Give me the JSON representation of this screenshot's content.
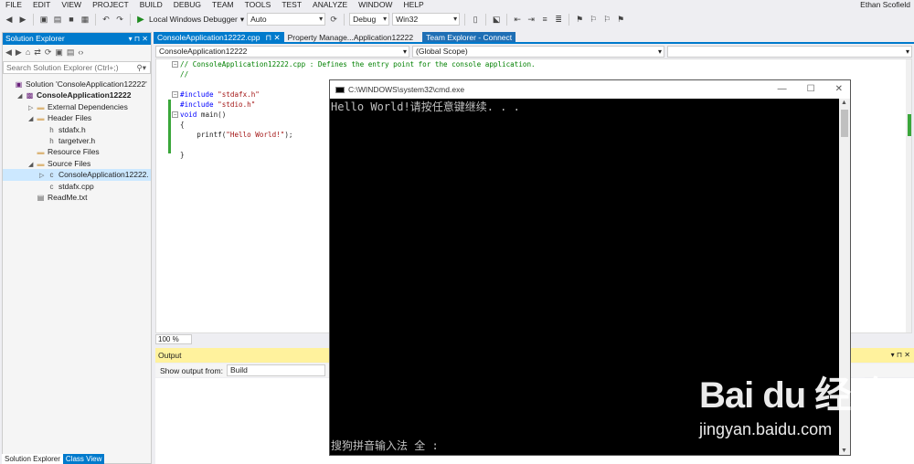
{
  "menu": [
    "FILE",
    "EDIT",
    "VIEW",
    "PROJECT",
    "BUILD",
    "DEBUG",
    "TEAM",
    "TOOLS",
    "TEST",
    "ANALYZE",
    "WINDOW",
    "HELP"
  ],
  "user": "Ethan Scofield",
  "toolbar": {
    "debugger_label": "Local Windows Debugger",
    "solution_config": "Debug",
    "platform": "Win32",
    "auto_combo": "Auto"
  },
  "solution_explorer": {
    "title": "Solution Explorer",
    "search_placeholder": "Search Solution Explorer (Ctrl+;)",
    "nodes": [
      {
        "label": "Solution 'ConsoleApplication12222'",
        "indent": 0,
        "expand": "",
        "icon": "solution-icon",
        "bold": false,
        "selected": false
      },
      {
        "label": "ConsoleApplication12222",
        "indent": 1,
        "expand": "◢",
        "icon": "project-icon",
        "bold": true,
        "selected": false
      },
      {
        "label": "External Dependencies",
        "indent": 2,
        "expand": "▷",
        "icon": "folder-icon",
        "bold": false,
        "selected": false
      },
      {
        "label": "Header Files",
        "indent": 2,
        "expand": "◢",
        "icon": "folder-icon",
        "bold": false,
        "selected": false
      },
      {
        "label": "stdafx.h",
        "indent": 3,
        "expand": "",
        "icon": "header-file-icon",
        "bold": false,
        "selected": false
      },
      {
        "label": "targetver.h",
        "indent": 3,
        "expand": "",
        "icon": "header-file-icon",
        "bold": false,
        "selected": false
      },
      {
        "label": "Resource Files",
        "indent": 2,
        "expand": "",
        "icon": "folder-icon",
        "bold": false,
        "selected": false
      },
      {
        "label": "Source Files",
        "indent": 2,
        "expand": "◢",
        "icon": "folder-icon",
        "bold": false,
        "selected": false
      },
      {
        "label": "ConsoleApplication12222.",
        "indent": 3,
        "expand": "▷",
        "icon": "cpp-file-icon",
        "bold": false,
        "selected": true
      },
      {
        "label": "stdafx.cpp",
        "indent": 3,
        "expand": "",
        "icon": "cpp-file-icon",
        "bold": false,
        "selected": false
      },
      {
        "label": "ReadMe.txt",
        "indent": 2,
        "expand": "",
        "icon": "text-file-icon",
        "bold": false,
        "selected": false
      }
    ],
    "bottom_tabs": [
      "Solution Explorer",
      "Class View"
    ]
  },
  "editor": {
    "tabs": [
      {
        "label": "ConsoleApplication12222.cpp",
        "state": "active"
      },
      {
        "label": "Property Manage...Application12222",
        "state": "normal"
      },
      {
        "label": "Team Explorer - Connect",
        "state": "inactive"
      }
    ],
    "nav_file": "ConsoleApplication12222",
    "nav_scope": "(Global Scope)",
    "zoom": "100 %",
    "lines": [
      {
        "parts": [
          {
            "t": "// ConsoleApplication12222.cpp : Defines the entry point for the console application.",
            "c": "c-cmt"
          }
        ]
      },
      {
        "parts": [
          {
            "t": "//",
            "c": "c-cmt"
          }
        ]
      },
      {
        "parts": [
          {
            "t": "",
            "c": ""
          }
        ]
      },
      {
        "parts": [
          {
            "t": "#include",
            "c": "c-kw"
          },
          {
            "t": " ",
            "c": ""
          },
          {
            "t": "\"stdafx.h\"",
            "c": "c-str"
          }
        ]
      },
      {
        "parts": [
          {
            "t": "#include",
            "c": "c-kw"
          },
          {
            "t": " ",
            "c": ""
          },
          {
            "t": "\"stdio.h\"",
            "c": "c-str"
          }
        ]
      },
      {
        "parts": [
          {
            "t": "void",
            "c": "c-kw"
          },
          {
            "t": " main()",
            "c": ""
          }
        ]
      },
      {
        "parts": [
          {
            "t": "{",
            "c": ""
          }
        ]
      },
      {
        "parts": [
          {
            "t": "    printf(",
            "c": ""
          },
          {
            "t": "\"Hello World!\"",
            "c": "c-str"
          },
          {
            "t": ");",
            "c": ""
          }
        ]
      },
      {
        "parts": [
          {
            "t": "",
            "c": ""
          }
        ]
      },
      {
        "parts": [
          {
            "t": "}",
            "c": ""
          }
        ]
      }
    ]
  },
  "output": {
    "title": "Output",
    "show_from_label": "Show output from:",
    "source": "Build"
  },
  "console": {
    "title": "C:\\WINDOWS\\system32\\cmd.exe",
    "line1": "Hello World!请按任意键继续. . .",
    "ime_text": "搜狗拼音输入法 全 :",
    "controls": [
      "—",
      "☐",
      "✕"
    ]
  },
  "watermark": {
    "logo": "Bai du 经验",
    "url": "jingyan.baidu.com"
  }
}
